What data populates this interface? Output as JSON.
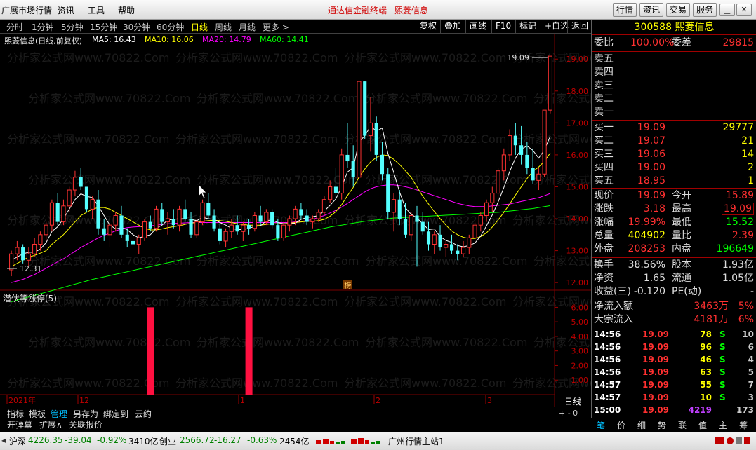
{
  "title_bar": {
    "app_title": "广展市场行情",
    "menus": [
      "资讯",
      "工具",
      "帮助"
    ],
    "terminal_name": "通达信金融终端",
    "stock_name": "熙菱信息",
    "buttons": [
      "行情",
      "资讯",
      "交易",
      "服务"
    ]
  },
  "period_bar": {
    "items": [
      "分时",
      "1分钟",
      "5分钟",
      "15分钟",
      "30分钟",
      "60分钟",
      "日线",
      "周线",
      "月线",
      "更多 >"
    ],
    "active_index": 6,
    "right_items": [
      "复权",
      "叠加",
      "画线",
      "F10",
      "标记",
      "+自选",
      "返回"
    ]
  },
  "ma_legend": {
    "title": "熙菱信息(日线,前复权)",
    "ma5": "MA5: 16.43",
    "ma10": "MA10: 16.06",
    "ma20": "MA20: 14.79",
    "ma60": "MA60: 14.41",
    "colors": {
      "ma5": "#ffffff",
      "ma10": "#ffff00",
      "ma20": "#ff00ff",
      "ma60": "#00ff00"
    }
  },
  "chart_data": {
    "type": "candlestick",
    "y_axis": [
      "19.00",
      "18.00",
      "17.00",
      "16.00",
      "15.00",
      "14.00",
      "13.00",
      "12.00"
    ],
    "ylim": [
      11.85,
      19.4
    ],
    "high_label": "19.09",
    "low_label": "12.31",
    "x_labels": [
      "2021年",
      "12",
      "1",
      "2",
      "3"
    ],
    "badge": "榜",
    "candles": [
      [
        12.4,
        13.0,
        12.2,
        12.9
      ],
      [
        12.9,
        13.3,
        12.7,
        13.1
      ],
      [
        13.1,
        13.2,
        12.6,
        12.7
      ],
      [
        12.7,
        13.1,
        12.5,
        12.9
      ],
      [
        12.9,
        13.4,
        12.8,
        13.2
      ],
      [
        13.2,
        13.6,
        13.0,
        13.5
      ],
      [
        13.5,
        13.9,
        13.3,
        13.8
      ],
      [
        13.8,
        14.6,
        13.6,
        14.5
      ],
      [
        14.5,
        14.8,
        13.8,
        13.9
      ],
      [
        13.9,
        14.6,
        13.8,
        14.4
      ],
      [
        14.4,
        15.0,
        14.2,
        14.9
      ],
      [
        14.9,
        15.5,
        14.7,
        15.3
      ],
      [
        15.3,
        15.6,
        14.9,
        15.0
      ],
      [
        15.0,
        15.0,
        14.2,
        14.3
      ],
      [
        14.3,
        14.7,
        14.0,
        14.6
      ],
      [
        14.6,
        14.9,
        13.5,
        13.7
      ],
      [
        13.7,
        14.0,
        13.3,
        13.5
      ],
      [
        13.5,
        13.9,
        13.1,
        13.8
      ],
      [
        13.8,
        14.2,
        13.6,
        14.1
      ],
      [
        14.1,
        14.4,
        13.4,
        13.5
      ],
      [
        13.5,
        13.7,
        13.1,
        13.3
      ],
      [
        13.3,
        13.6,
        13.0,
        13.2
      ],
      [
        13.2,
        13.5,
        12.9,
        13.4
      ],
      [
        13.4,
        14.0,
        13.3,
        13.9
      ],
      [
        13.9,
        14.1,
        13.6,
        13.7
      ],
      [
        13.7,
        14.4,
        13.6,
        14.3
      ],
      [
        14.3,
        14.5,
        13.8,
        13.9
      ],
      [
        13.9,
        14.2,
        13.5,
        14.0
      ],
      [
        14.0,
        14.3,
        13.7,
        13.8
      ],
      [
        13.8,
        14.4,
        13.6,
        14.3
      ],
      [
        14.3,
        14.6,
        13.9,
        14.0
      ],
      [
        14.0,
        14.2,
        13.4,
        13.5
      ],
      [
        13.5,
        14.0,
        13.4,
        13.9
      ],
      [
        13.9,
        14.6,
        13.8,
        14.5
      ],
      [
        14.5,
        14.8,
        14.0,
        14.1
      ],
      [
        14.1,
        14.3,
        13.6,
        13.7
      ],
      [
        13.7,
        13.9,
        13.2,
        13.3
      ],
      [
        13.3,
        13.7,
        13.1,
        13.6
      ],
      [
        13.6,
        14.0,
        13.4,
        13.8
      ],
      [
        13.8,
        14.1,
        13.5,
        13.6
      ],
      [
        13.6,
        13.9,
        13.3,
        13.8
      ],
      [
        13.8,
        14.0,
        13.5,
        13.7
      ],
      [
        13.7,
        14.2,
        13.6,
        14.1
      ],
      [
        14.1,
        14.4,
        13.8,
        13.9
      ],
      [
        13.9,
        14.3,
        13.8,
        14.2
      ],
      [
        14.2,
        14.3,
        13.7,
        13.8
      ],
      [
        13.8,
        14.0,
        13.3,
        13.4
      ],
      [
        13.4,
        13.9,
        13.3,
        13.8
      ],
      [
        13.8,
        14.1,
        13.6,
        14.0
      ],
      [
        14.0,
        14.4,
        13.8,
        14.3
      ],
      [
        14.3,
        14.5,
        14.0,
        14.1
      ],
      [
        14.1,
        14.3,
        13.8,
        13.9
      ],
      [
        13.9,
        14.1,
        13.7,
        14.0
      ],
      [
        14.0,
        14.3,
        13.9,
        14.2
      ],
      [
        14.2,
        14.7,
        14.1,
        14.6
      ],
      [
        14.6,
        15.2,
        14.5,
        15.0
      ],
      [
        15.0,
        15.6,
        14.6,
        14.8
      ],
      [
        14.8,
        16.2,
        14.6,
        16.0
      ],
      [
        16.0,
        17.0,
        15.6,
        15.8
      ],
      [
        15.8,
        16.3,
        15.0,
        15.3
      ],
      [
        15.3,
        17.2,
        15.2,
        18.3
      ],
      [
        18.3,
        18.3,
        16.5,
        16.6
      ],
      [
        16.6,
        17.8,
        16.1,
        17.0
      ],
      [
        17.0,
        17.2,
        15.8,
        16.0
      ],
      [
        16.0,
        16.4,
        15.2,
        15.4
      ],
      [
        15.4,
        15.6,
        14.0,
        14.2
      ],
      [
        14.2,
        14.8,
        13.6,
        14.6
      ],
      [
        14.6,
        14.9,
        13.8,
        14.0
      ],
      [
        14.0,
        14.5,
        13.4,
        13.5
      ],
      [
        13.5,
        14.2,
        13.3,
        14.1
      ],
      [
        14.1,
        14.4,
        12.5,
        13.9
      ],
      [
        13.9,
        14.2,
        13.5,
        13.6
      ],
      [
        13.6,
        13.9,
        13.0,
        13.2
      ],
      [
        13.2,
        13.6,
        12.9,
        13.5
      ],
      [
        13.5,
        13.8,
        13.0,
        13.1
      ],
      [
        13.1,
        13.3,
        12.8,
        13.2
      ],
      [
        13.2,
        13.5,
        12.9,
        13.0
      ],
      [
        13.0,
        13.2,
        12.7,
        12.9
      ],
      [
        12.9,
        13.3,
        12.8,
        13.1
      ],
      [
        13.1,
        13.5,
        12.9,
        13.4
      ],
      [
        13.4,
        13.9,
        13.2,
        13.8
      ],
      [
        13.8,
        14.2,
        13.6,
        14.1
      ],
      [
        14.1,
        14.6,
        13.9,
        14.5
      ],
      [
        14.5,
        15.0,
        14.2,
        14.8
      ],
      [
        14.8,
        15.6,
        14.5,
        15.5
      ],
      [
        15.5,
        16.2,
        15.2,
        16.0
      ],
      [
        16.0,
        16.8,
        15.8,
        16.6
      ],
      [
        16.6,
        17.0,
        16.0,
        16.3
      ],
      [
        16.3,
        16.9,
        15.7,
        16.0
      ],
      [
        16.0,
        16.4,
        15.4,
        15.6
      ],
      [
        15.6,
        16.2,
        15.1,
        15.2
      ],
      [
        15.2,
        15.6,
        14.9,
        15.4
      ],
      [
        15.4,
        17.4,
        15.3,
        17.4
      ],
      [
        17.4,
        19.09,
        17.3,
        19.09
      ]
    ],
    "ma_lines": {
      "ma5": [
        12.7,
        12.8,
        12.9,
        12.95,
        12.95,
        13.05,
        13.25,
        13.6,
        13.75,
        14.0,
        14.3,
        14.6,
        14.78,
        14.7,
        14.66,
        14.4,
        14.1,
        13.8,
        13.68,
        13.72,
        13.66,
        13.5,
        13.4,
        13.45,
        13.5,
        13.7,
        13.8,
        13.96,
        13.98,
        14.0,
        14.0,
        13.98,
        13.94,
        14.04,
        14.0,
        13.98,
        13.88,
        13.8,
        13.7,
        13.66,
        13.66,
        13.7,
        13.76,
        13.78,
        13.94,
        13.96,
        13.88,
        13.84,
        13.84,
        13.86,
        13.98,
        14.04,
        14.06,
        14.1,
        14.24,
        14.42,
        14.62,
        15.0,
        15.46,
        15.6,
        16.4,
        16.6,
        16.9,
        16.74,
        16.84,
        16.04,
        15.44,
        14.84,
        14.34,
        14.14,
        14.02,
        13.84,
        13.66,
        13.68,
        13.44,
        13.32,
        13.26,
        13.16,
        13.12,
        13.16,
        13.24,
        13.46,
        13.78,
        14.12,
        14.52,
        14.98,
        15.48,
        15.9,
        16.18,
        16.28,
        16.14,
        15.9,
        16.16,
        16.58
      ],
      "ma10": [
        12.5,
        12.6,
        12.7,
        12.8,
        12.85,
        12.92,
        13.0,
        13.2,
        13.35,
        13.5,
        13.7,
        13.9,
        14.1,
        14.2,
        14.3,
        14.35,
        14.35,
        14.3,
        14.2,
        14.1,
        14.0,
        13.9,
        13.8,
        13.7,
        13.65,
        13.65,
        13.68,
        13.72,
        13.75,
        13.78,
        13.82,
        13.86,
        13.88,
        13.92,
        13.94,
        13.95,
        13.94,
        13.92,
        13.88,
        13.84,
        13.82,
        13.8,
        13.8,
        13.8,
        13.82,
        13.84,
        13.84,
        13.84,
        13.86,
        13.88,
        13.9,
        13.92,
        13.92,
        13.94,
        13.98,
        14.08,
        14.22,
        14.44,
        14.72,
        14.98,
        15.3,
        15.56,
        15.78,
        15.92,
        16.0,
        15.98,
        15.86,
        15.7,
        15.5,
        15.3,
        15.0,
        14.7,
        14.46,
        14.22,
        14.0,
        13.8,
        13.62,
        13.5,
        13.42,
        13.38,
        13.38,
        13.44,
        13.56,
        13.74,
        13.96,
        14.2,
        14.46,
        14.74,
        15.0,
        15.26,
        15.48,
        15.62,
        15.8,
        16.06
      ],
      "ma20": [
        12.0,
        12.05,
        12.1,
        12.18,
        12.25,
        12.35,
        12.45,
        12.55,
        12.65,
        12.75,
        12.86,
        12.98,
        13.1,
        13.2,
        13.3,
        13.4,
        13.48,
        13.55,
        13.62,
        13.68,
        13.72,
        13.74,
        13.75,
        13.76,
        13.78,
        13.8,
        13.82,
        13.84,
        13.85,
        13.86,
        13.87,
        13.88,
        13.88,
        13.88,
        13.88,
        13.88,
        13.88,
        13.88,
        13.88,
        13.88,
        13.88,
        13.88,
        13.88,
        13.88,
        13.88,
        13.88,
        13.88,
        13.88,
        13.88,
        13.9,
        13.92,
        13.94,
        13.98,
        14.04,
        14.1,
        14.18,
        14.26,
        14.36,
        14.48,
        14.6,
        14.72,
        14.84,
        14.94,
        15.0,
        15.04,
        15.06,
        15.06,
        15.04,
        15.0,
        14.96,
        14.9,
        14.84,
        14.78,
        14.72,
        14.66,
        14.6,
        14.54,
        14.48,
        14.44,
        14.4,
        14.38,
        14.38,
        14.38,
        14.4,
        14.42,
        14.44,
        14.46,
        14.5,
        14.54,
        14.58,
        14.62,
        14.66,
        14.72,
        14.79
      ],
      "ma60": [
        11.4,
        11.45,
        11.5,
        11.55,
        11.6,
        11.65,
        11.7,
        11.75,
        11.8,
        11.85,
        11.9,
        11.95,
        12.0,
        12.05,
        12.1,
        12.14,
        12.18,
        12.22,
        12.26,
        12.3,
        12.34,
        12.38,
        12.42,
        12.46,
        12.5,
        12.54,
        12.58,
        12.62,
        12.66,
        12.7,
        12.74,
        12.78,
        12.82,
        12.86,
        12.9,
        12.94,
        12.98,
        13.02,
        13.06,
        13.1,
        13.14,
        13.18,
        13.22,
        13.26,
        13.3,
        13.34,
        13.38,
        13.42,
        13.46,
        13.5,
        13.54,
        13.58,
        13.62,
        13.66,
        13.7,
        13.74,
        13.77,
        13.8,
        13.83,
        13.86,
        13.89,
        13.92,
        13.94,
        13.96,
        13.98,
        14.0,
        14.02,
        14.03,
        14.04,
        14.05,
        14.06,
        14.07,
        14.08,
        14.09,
        14.1,
        14.11,
        14.12,
        14.13,
        14.14,
        14.15,
        14.16,
        14.17,
        14.18,
        14.19,
        14.2,
        14.22,
        14.24,
        14.26,
        14.28,
        14.3,
        14.32,
        14.35,
        14.38,
        14.41
      ]
    },
    "indicator": {
      "name": "潜伏等涨停(5)",
      "y_axis": [
        "6.00",
        "5.00",
        "4.00",
        "3.00",
        "2.00",
        "1.00"
      ],
      "ylim": [
        0,
        6.5
      ],
      "bars": [
        {
          "index": 24,
          "value": 6.0
        },
        {
          "index": 41,
          "value": 6.0
        }
      ]
    }
  },
  "bottom_tabs": {
    "row1": [
      "指标",
      "模板",
      "管理",
      "另存为",
      "绑定到",
      "云约"
    ],
    "active_index": 2,
    "row2": [
      "开弹幕",
      "扩展∧",
      "关联报价"
    ],
    "right_label": "日线",
    "right_ctl": "+ - 0"
  },
  "quote_panel": {
    "code_name": "300588 熙菱信息",
    "weibi_label": "委比",
    "weibi": "100.00%",
    "weicha_label": "委差",
    "weicha": "29815",
    "sell": [
      {
        "label": "卖五"
      },
      {
        "label": "卖四"
      },
      {
        "label": "卖三"
      },
      {
        "label": "卖二"
      },
      {
        "label": "卖一"
      }
    ],
    "buy": [
      {
        "label": "买一",
        "price": "19.09",
        "vol": "29777"
      },
      {
        "label": "买二",
        "price": "19.07",
        "vol": "21"
      },
      {
        "label": "买三",
        "price": "19.06",
        "vol": "14"
      },
      {
        "label": "买四",
        "price": "19.00",
        "vol": "2"
      },
      {
        "label": "买五",
        "price": "18.95",
        "vol": "1"
      }
    ],
    "stats": [
      {
        "l1": "现价",
        "v1": "19.09",
        "l2": "今开",
        "v2": "15.89"
      },
      {
        "l1": "涨跌",
        "v1": "3.18",
        "l2": "最高",
        "v2": "19.09"
      },
      {
        "l1": "涨幅",
        "v1": "19.99%",
        "l2": "最低",
        "v2": "15.52"
      },
      {
        "l1": "总量",
        "v1": "404902",
        "l2": "量比",
        "v2": "2.39"
      },
      {
        "l1": "外盘",
        "v1": "208253",
        "l2": "内盘",
        "v2": "196649"
      }
    ],
    "stats2": [
      {
        "l1": "换手",
        "v1": "38.56%",
        "l2": "股本",
        "v2": "1.93亿"
      },
      {
        "l1": "净资",
        "v1": "1.65",
        "l2": "流通",
        "v2": "1.05亿"
      },
      {
        "l1": "收益(三)",
        "v1": "-0.120",
        "l2": "PE(动)",
        "v2": "-"
      }
    ],
    "flows": [
      {
        "label": "净流入额",
        "value": "3463万",
        "pct": "5%"
      },
      {
        "label": "大宗流入",
        "value": "4181万",
        "pct": "6%"
      }
    ],
    "ticks": [
      {
        "time": "14:56",
        "price": "19.09",
        "vol": "78",
        "bs": "S",
        "n": "10"
      },
      {
        "time": "14:56",
        "price": "19.09",
        "vol": "96",
        "bs": "S",
        "n": "6"
      },
      {
        "time": "14:56",
        "price": "19.09",
        "vol": "46",
        "bs": "S",
        "n": "4"
      },
      {
        "time": "14:56",
        "price": "19.09",
        "vol": "63",
        "bs": "S",
        "n": "5"
      },
      {
        "time": "14:57",
        "price": "19.09",
        "vol": "55",
        "bs": "S",
        "n": "7"
      },
      {
        "time": "14:57",
        "price": "19.09",
        "vol": "10",
        "bs": "S",
        "n": "3"
      },
      {
        "time": "15:00",
        "price": "19.09",
        "vol": "4219",
        "bs": "",
        "n": "173"
      }
    ],
    "tabs": [
      "笔",
      "价",
      "细",
      "势",
      "联",
      "值",
      "主",
      "筹"
    ],
    "active_tab": 0
  },
  "status_bar": {
    "sh_label": "沪深",
    "sh_value": "4226.35",
    "sh_change": "-39.04",
    "sh_pct": "-0.92%",
    "sh_amount": "3410亿",
    "cy_label": "创业",
    "cy_value": "2566.72",
    "cy_change": "-16.27",
    "cy_pct": "-0.63%",
    "cy_amount": "2454亿",
    "server": "广州行情主站1"
  },
  "watermark": "分析家公式网www.70822.Com"
}
